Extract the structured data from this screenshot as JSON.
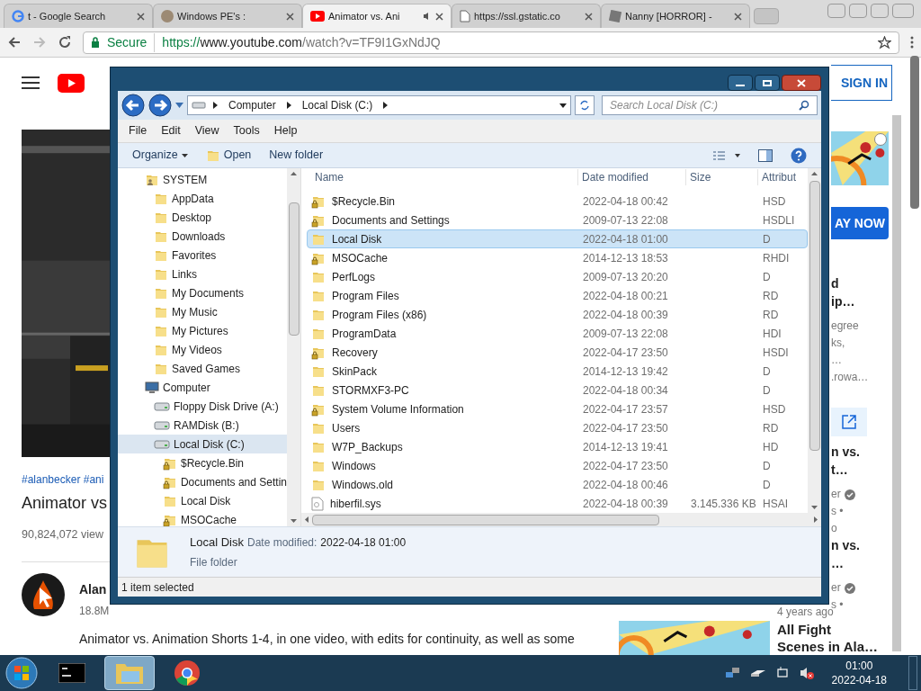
{
  "browser": {
    "tabs": [
      {
        "title": "t - Google Search",
        "kind": "google",
        "selected": false,
        "audio": false
      },
      {
        "title": "Windows PE's :",
        "kind": "avatar",
        "selected": false,
        "audio": false
      },
      {
        "title": "Animator vs. Ani",
        "kind": "youtube",
        "selected": true,
        "audio": true
      },
      {
        "title": "https://ssl.gstatic.co",
        "kind": "page",
        "selected": false,
        "audio": false
      },
      {
        "title": "Nanny [HORROR] -",
        "kind": "game",
        "selected": false,
        "audio": false
      }
    ],
    "security": "Secure",
    "url_scheme": "https://",
    "url_host": "www.youtube.com",
    "url_path": "/watch?v=TF9I1GxNdJQ"
  },
  "youtube": {
    "sign_in": "SIGN IN",
    "hashtags": "#alanbecker #ani",
    "title": "Animator vs",
    "views": "90,824,072 view",
    "channel": "Alan",
    "subscribers": "18.8M",
    "description": "Animator vs. Animation Shorts 1-4, in one video, with edits for continuity, as well as some",
    "ad_button": "AY NOW",
    "cards": [
      {
        "title": [
          "d",
          "ip…"
        ],
        "meta": [
          "egree",
          "ks,",
          "…",
          ".rowa…"
        ],
        "verified": false
      },
      {
        "title": [
          "n vs.",
          "t…"
        ],
        "meta": [
          "er",
          "s •",
          "o"
        ],
        "verified": true
      },
      {
        "title": [
          "n vs.",
          "…"
        ],
        "meta": [
          "er",
          "s •"
        ],
        "verified": true,
        "age": "4 years ago"
      }
    ],
    "last_card": [
      "All Fight",
      "Scenes in Ala…"
    ]
  },
  "explorer": {
    "breadcrumb": [
      "Computer",
      "Local Disk (C:)"
    ],
    "search_placeholder": "Search Local Disk (C:)",
    "menu": [
      "File",
      "Edit",
      "View",
      "Tools",
      "Help"
    ],
    "commands": [
      {
        "label": "Organize",
        "kind": "dropdown"
      },
      {
        "label": "Open",
        "kind": "open"
      },
      {
        "label": "New folder",
        "kind": "plain"
      }
    ],
    "tree": [
      {
        "label": "SYSTEM",
        "kind": "user",
        "selected": false,
        "children": [
          {
            "label": "AppData",
            "kind": "folder",
            "selected": false
          },
          {
            "label": "Desktop",
            "kind": "folder",
            "selected": false
          },
          {
            "label": "Downloads",
            "kind": "folder",
            "selected": false
          },
          {
            "label": "Favorites",
            "kind": "folder",
            "selected": false
          },
          {
            "label": "Links",
            "kind": "folder",
            "selected": false
          },
          {
            "label": "My Documents",
            "kind": "folder",
            "selected": false
          },
          {
            "label": "My Music",
            "kind": "folder",
            "selected": false
          },
          {
            "label": "My Pictures",
            "kind": "folder",
            "selected": false
          },
          {
            "label": "My Videos",
            "kind": "folder",
            "selected": false
          },
          {
            "label": "Saved Games",
            "kind": "folder",
            "selected": false
          }
        ]
      },
      {
        "label": "Computer",
        "kind": "computer",
        "selected": false,
        "children": [
          {
            "label": "Floppy Disk Drive (A:)",
            "kind": "drive",
            "selected": false
          },
          {
            "label": "RAMDisk (B:)",
            "kind": "drive",
            "selected": false
          },
          {
            "label": "Local Disk (C:)",
            "kind": "drive",
            "selected": true,
            "children": [
              {
                "label": "$Recycle.Bin",
                "kind": "locked",
                "selected": false
              },
              {
                "label": "Documents and Settin",
                "kind": "locked",
                "selected": false
              },
              {
                "label": "Local Disk",
                "kind": "folder",
                "selected": false
              },
              {
                "label": "MSOCache",
                "kind": "locked",
                "selected": false
              }
            ]
          }
        ]
      }
    ],
    "columns": [
      "Name",
      "Date modified",
      "Size",
      "Attribut"
    ],
    "files": [
      {
        "name": "$Recycle.Bin",
        "kind": "locked",
        "date": "2022-04-18 00:42",
        "attributes": "HSD",
        "selected": false
      },
      {
        "name": "Documents and Settings",
        "kind": "locked",
        "date": "2009-07-13 22:08",
        "attributes": "HSDLI",
        "selected": false
      },
      {
        "name": "Local Disk",
        "kind": "folder",
        "date": "2022-04-18 01:00",
        "attributes": "D",
        "selected": true
      },
      {
        "name": "MSOCache",
        "kind": "locked",
        "date": "2014-12-13 18:53",
        "attributes": "RHDI",
        "selected": false
      },
      {
        "name": "PerfLogs",
        "kind": "folder",
        "date": "2009-07-13 20:20",
        "attributes": "D",
        "selected": false
      },
      {
        "name": "Program Files",
        "kind": "folder",
        "date": "2022-04-18 00:21",
        "attributes": "RD",
        "selected": false
      },
      {
        "name": "Program Files (x86)",
        "kind": "folder",
        "date": "2022-04-18 00:39",
        "attributes": "RD",
        "selected": false
      },
      {
        "name": "ProgramData",
        "kind": "folder",
        "date": "2009-07-13 22:08",
        "attributes": "HDI",
        "selected": false
      },
      {
        "name": "Recovery",
        "kind": "locked",
        "date": "2022-04-17 23:50",
        "attributes": "HSDI",
        "selected": false
      },
      {
        "name": "SkinPack",
        "kind": "folder",
        "date": "2014-12-13 19:42",
        "attributes": "D",
        "selected": false
      },
      {
        "name": "STORMXF3-PC",
        "kind": "folder",
        "date": "2022-04-18 00:34",
        "attributes": "D",
        "selected": false
      },
      {
        "name": "System Volume Information",
        "kind": "locked",
        "date": "2022-04-17 23:57",
        "attributes": "HSD",
        "selected": false
      },
      {
        "name": "Users",
        "kind": "folder",
        "date": "2022-04-17 23:50",
        "attributes": "RD",
        "selected": false
      },
      {
        "name": "W7P_Backups",
        "kind": "folder",
        "date": "2014-12-13 19:41",
        "attributes": "HD",
        "selected": false
      },
      {
        "name": "Windows",
        "kind": "folder",
        "date": "2022-04-17 23:50",
        "attributes": "D",
        "selected": false
      },
      {
        "name": "Windows.old",
        "kind": "folder",
        "date": "2022-04-18 00:46",
        "attributes": "D",
        "selected": false
      },
      {
        "name": "hiberfil.sys",
        "kind": "file",
        "date": "2022-04-18 00:39",
        "size": "3.145.336 KB",
        "attributes": "HSAI",
        "selected": false
      }
    ],
    "details": {
      "name": "Local Disk",
      "date_label": "Date modified:",
      "date": "2022-04-18 01:00",
      "type": "File folder"
    },
    "status": "1 item selected"
  },
  "taskbar": {
    "items": [
      {
        "kind": "cmd",
        "selected": false
      },
      {
        "kind": "explorer",
        "selected": true
      },
      {
        "kind": "chrome",
        "selected": false
      }
    ],
    "time": "01:00",
    "date": "2022-04-18"
  }
}
